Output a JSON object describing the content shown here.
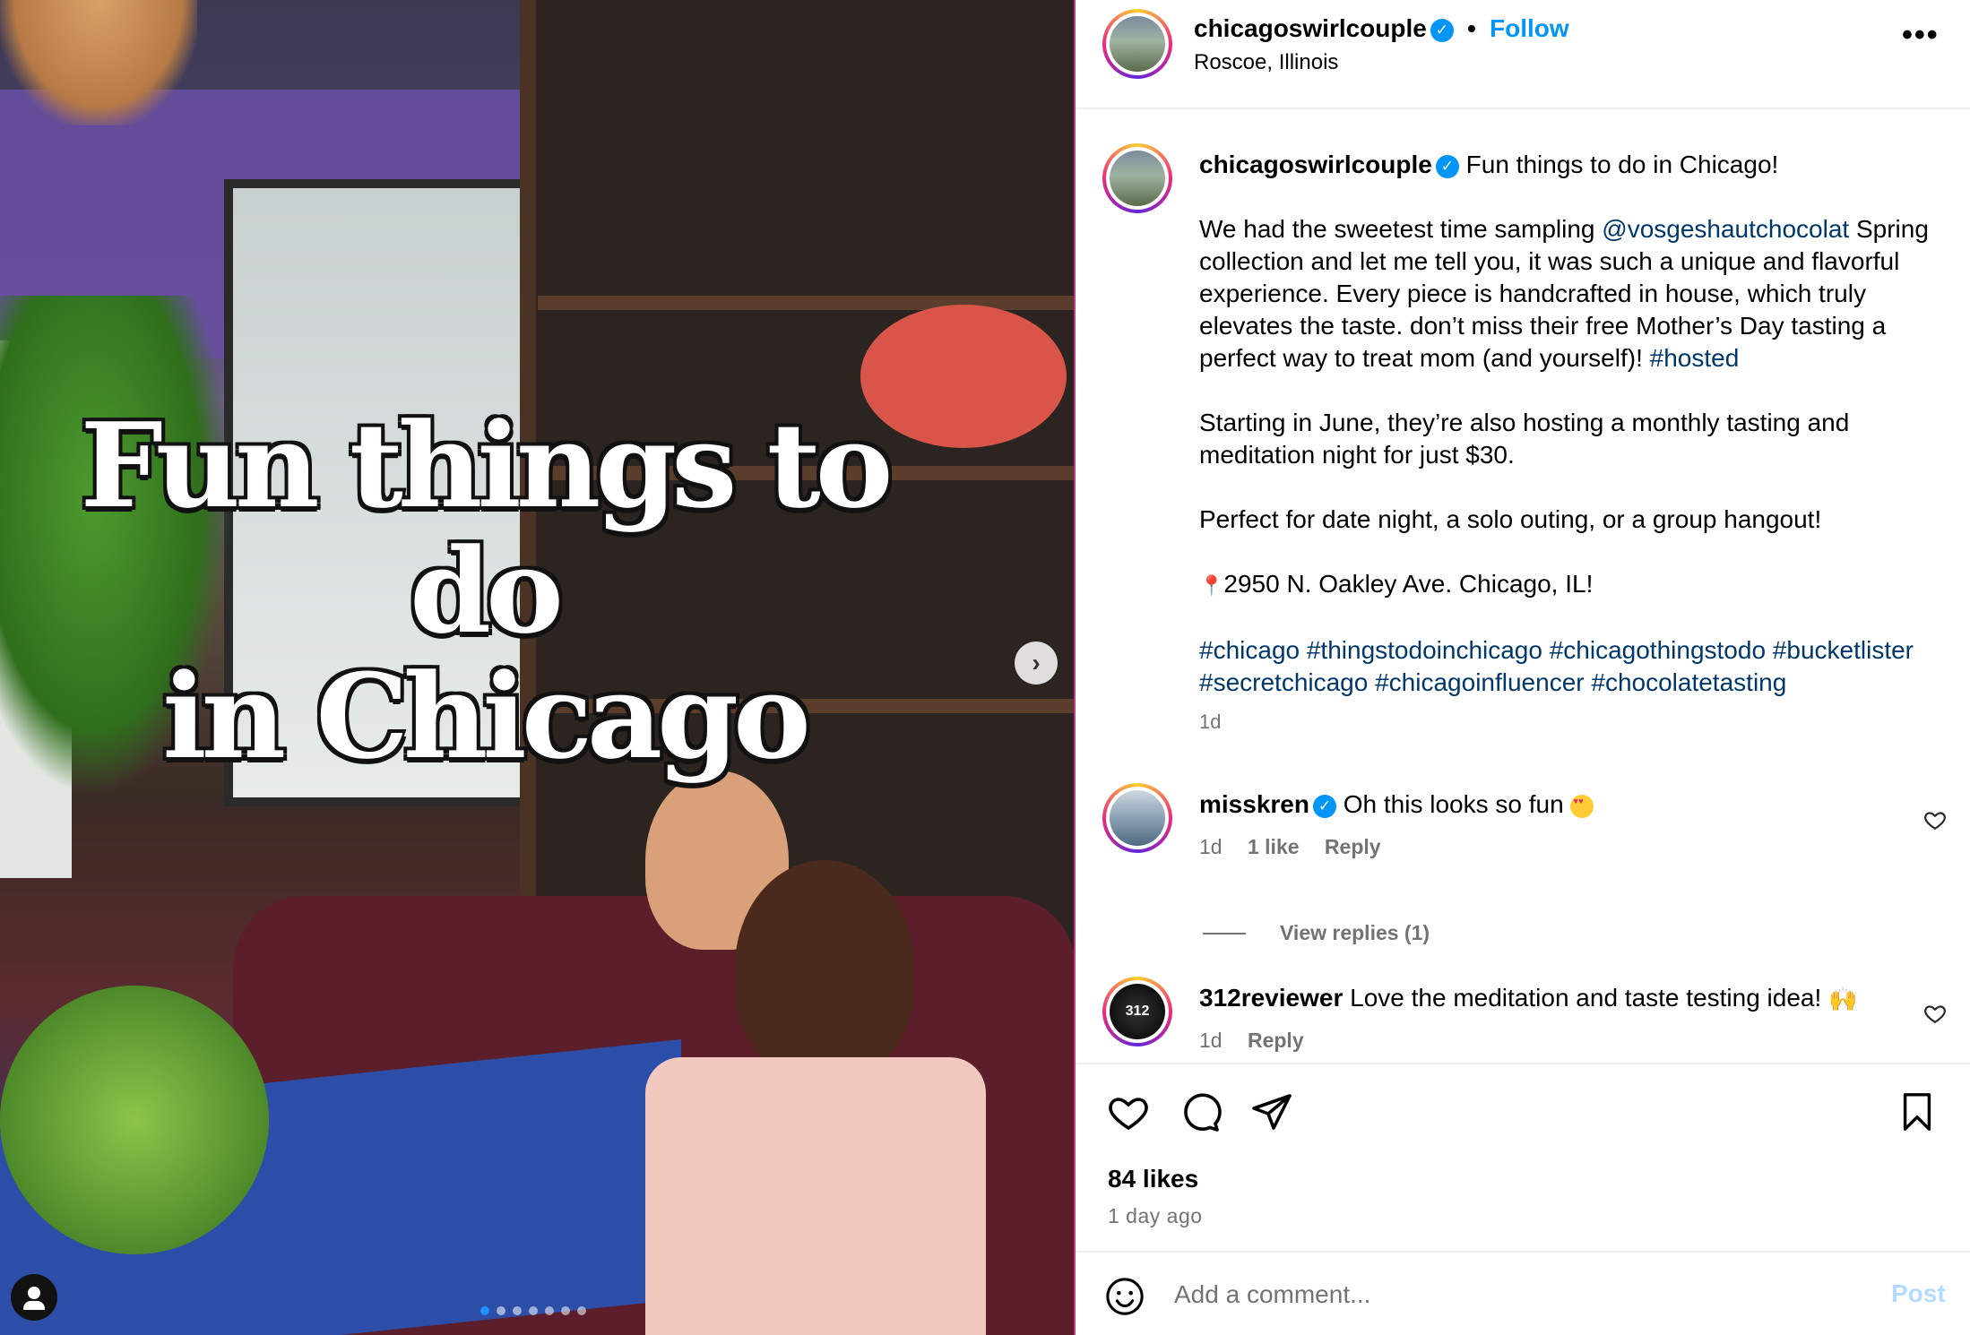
{
  "media": {
    "overlay_title_line1": "Fun things to do",
    "overlay_title_line2": "in Chicago",
    "carousel_dots": 7,
    "active_dot": 0
  },
  "header": {
    "username": "chicagoswirlcouple",
    "separator": "•",
    "follow_label": "Follow",
    "location": "Roscoe, Illinois",
    "more_label": "•••"
  },
  "caption": {
    "username": "chicagoswirlcouple",
    "title": "Fun things to do in Chicago!",
    "p1_before": "We had the sweetest time sampling ",
    "p1_mention": "@vosgeshautchocolat",
    "p1_middle": " Spring collection and let me tell you, it was such a unique and flavorful experience. Every piece is handcrafted in house, which truly elevates the taste. don’t miss their free Mother’s Day tasting a perfect way to treat mom (and yourself)! ",
    "p1_hashtag": "#hosted",
    "p2": "Starting in June, they’re also hosting a monthly tasting and meditation night for just $30.",
    "p3": "Perfect for date night, a solo outing, or a group hangout!",
    "address_pin": "📍",
    "address": "2950 N. Oakley Ave. Chicago, IL!",
    "hashtags": "#chicago #thingstodoinchicago #chicagothingstodo #bucketlister #secretchicago #chicagoinfluencer #chocolatetasting",
    "time": "1d"
  },
  "comments": [
    {
      "username": "misskren",
      "verified": true,
      "text": "Oh this looks so fun",
      "emoji": "heart-eyes-emoji",
      "time": "1d",
      "likes": "1 like",
      "reply_label": "Reply",
      "view_replies": "View replies (1)"
    },
    {
      "username": "312reviewer",
      "verified": false,
      "avatar_text": "312",
      "text": "Love the meditation and taste testing idea!",
      "emoji": "raised-hands-emoji",
      "time": "1d",
      "reply_label": "Reply"
    }
  ],
  "stats": {
    "likes": "84 likes",
    "posted": "1 day ago"
  },
  "composer": {
    "placeholder": "Add a comment...",
    "post_label": "Post"
  },
  "colors": {
    "accent": "#0095f6",
    "link": "#00376b",
    "muted": "#737373",
    "post_disabled": "#b3dbff"
  }
}
